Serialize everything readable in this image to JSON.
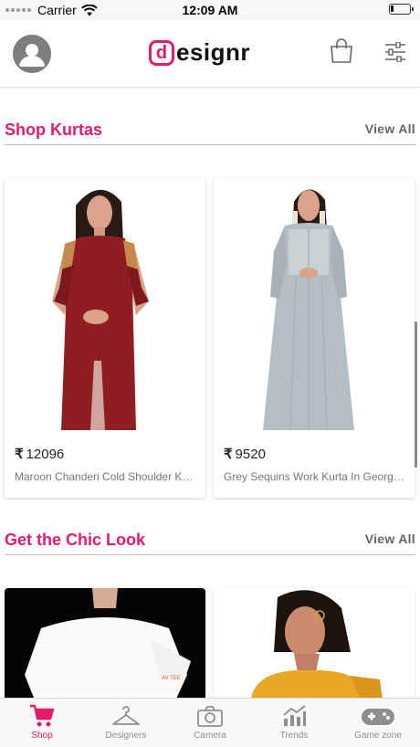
{
  "status_bar": {
    "carrier": "Carrier",
    "time": "12:09 AM"
  },
  "header": {
    "logo_mark": "d",
    "logo_text": "esignr",
    "icons": [
      "avatar-icon",
      "shopping-bag-icon",
      "filter-sliders-icon"
    ]
  },
  "sections": [
    {
      "title": "Shop Kurtas",
      "view_all": "View All",
      "products": [
        {
          "price": "12096",
          "name": "Maroon Chanderi Cold Shoulder Kurta"
        },
        {
          "price": "9520",
          "name": "Grey Sequins Work Kurta In Georgette"
        }
      ]
    },
    {
      "title": "Get the Chic Look",
      "view_all": "View All"
    }
  ],
  "currency_symbol": "₹",
  "tab_bar": {
    "tabs": [
      {
        "label": "Shop",
        "icon": "cart-icon",
        "active": true
      },
      {
        "label": "Designers",
        "icon": "hanger-icon",
        "active": false
      },
      {
        "label": "Camera",
        "icon": "camera-icon",
        "active": false
      },
      {
        "label": "Trends",
        "icon": "trends-chart-icon",
        "active": false
      },
      {
        "label": "Game zone",
        "icon": "gamepad-icon",
        "active": false
      }
    ]
  },
  "colors": {
    "accent": "#e31b6d",
    "muted_text": "#777777"
  }
}
